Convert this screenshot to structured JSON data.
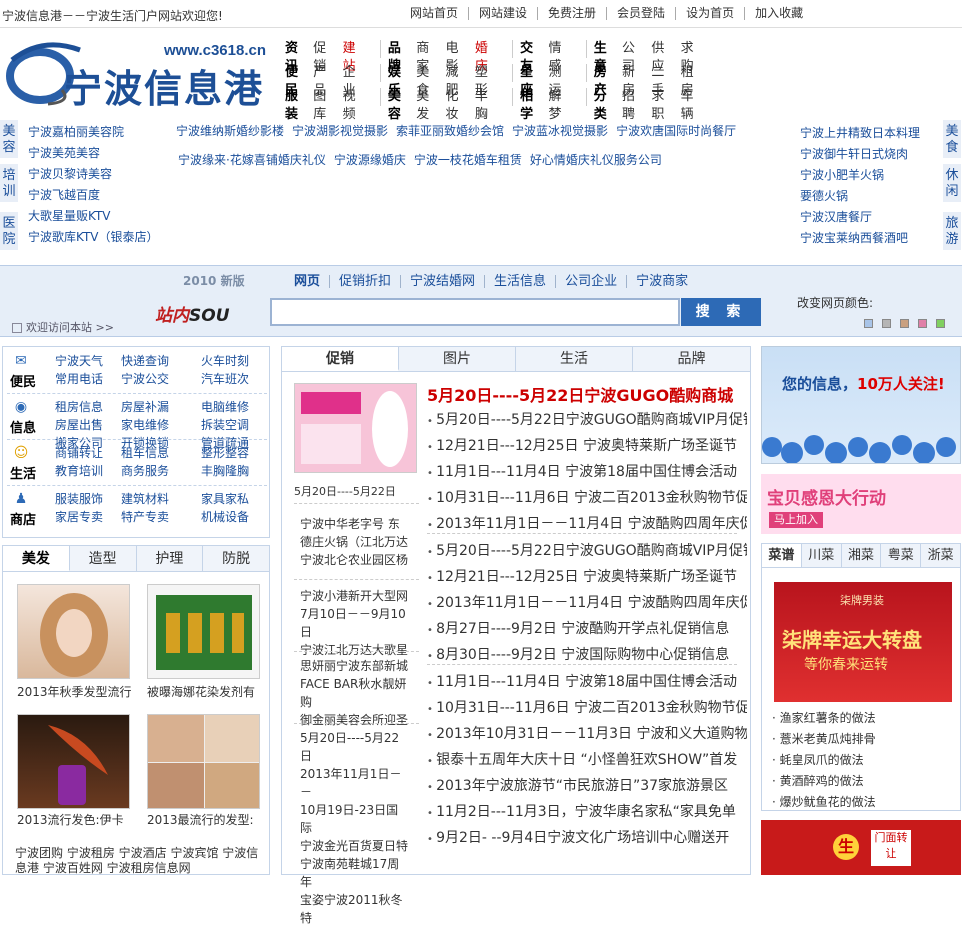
{
  "topbar": {
    "welcome": "宁波信息港－－宁波生活门户网站欢迎您!",
    "links": [
      "网站首页",
      "网站建设",
      "免费注册",
      "会员登陆",
      "设为首页",
      "加入收藏"
    ]
  },
  "logo": {
    "name": "宁波信息港",
    "url": "www.c3618.cn"
  },
  "catnav": [
    [
      {
        "head": "资讯",
        "items": [
          {
            "t": "促销"
          },
          {
            "t": "建站",
            "red": true
          }
        ]
      },
      {
        "head": "品牌",
        "items": [
          {
            "t": "商家"
          },
          {
            "t": "电影"
          },
          {
            "t": "婚庆",
            "red": true
          }
        ]
      },
      {
        "head": "交友",
        "items": [
          {
            "t": "情感"
          }
        ]
      },
      {
        "head": "生意",
        "items": [
          {
            "t": "公司"
          },
          {
            "t": "供应"
          },
          {
            "t": "求购"
          }
        ]
      }
    ],
    [
      {
        "head": "便民",
        "items": [
          {
            "t": "产品"
          },
          {
            "t": "企业"
          }
        ]
      },
      {
        "head": "娱乐",
        "items": [
          {
            "t": "美食"
          },
          {
            "t": "减肥"
          },
          {
            "t": "塑形"
          }
        ]
      },
      {
        "head": "星座",
        "items": [
          {
            "t": "测运"
          }
        ]
      },
      {
        "head": "房产",
        "items": [
          {
            "t": "新房"
          },
          {
            "t": "二手"
          },
          {
            "t": "租房"
          }
        ]
      }
    ],
    [
      {
        "head": "服装",
        "items": [
          {
            "t": "图库"
          },
          {
            "t": "视频"
          }
        ]
      },
      {
        "head": "美容",
        "items": [
          {
            "t": "美发"
          },
          {
            "t": "化妆"
          },
          {
            "t": "丰胸"
          }
        ]
      },
      {
        "head": "相学",
        "items": [
          {
            "t": "解梦"
          }
        ]
      },
      {
        "head": "分类",
        "items": [
          {
            "t": "招聘"
          },
          {
            "t": "求职"
          },
          {
            "t": "车辆"
          }
        ]
      }
    ]
  ],
  "ads": {
    "left_tabs": [
      "美容",
      "培训",
      "医院"
    ],
    "right_tabs": [
      "美食",
      "休闲",
      "旅游"
    ],
    "left_col": [
      "宁波嘉柏丽美容院",
      "宁波美苑美容",
      "宁波贝黎诗美容",
      "宁波飞越百度",
      "大歌星量贩KTV",
      "宁波歌库KTV（银泰店）"
    ],
    "mid_row1": [
      "宁波维纳斯婚纱影楼",
      "宁波湖影视觉摄影",
      "索菲亚丽致婚纱会馆",
      "宁波蓝冰视觉摄影",
      "宁波欢唐国际时尚餐厅"
    ],
    "mid_row2": [
      "宁波缘来·花嫁喜铺婚庆礼仪",
      "宁波源缘婚庆",
      "宁波一枝花婚车租赁",
      "好心情婚庆礼仪服务公司"
    ],
    "right_col": [
      "宁波上井精致日本料理",
      "宁波御牛轩日式烧肉",
      "宁波小肥羊火锅",
      "要德火锅",
      "宁波汉唐餐厅",
      "宁波宝莱纳西餐酒吧"
    ]
  },
  "search": {
    "version": "2010 新版",
    "tabs": [
      "网页",
      "促销折扣",
      "宁波结婚网",
      "生活信息",
      "公司企业",
      "宁波商家"
    ],
    "brand_red": "站内",
    "brand_dark": "SOU",
    "placeholder": "",
    "button": "搜 索",
    "color_label": "改变网页颜色:",
    "welcome": "欢迎访问本站 >>",
    "swatches": [
      "#a8c4e8",
      "#b5b5b5",
      "#c9a080",
      "#e080a8",
      "#80d060"
    ]
  },
  "services": [
    {
      "label": "便民",
      "icon": "mail-icon",
      "items": [
        "宁波天气",
        "快递查询",
        "火车时刻",
        "常用电话",
        "宁波公交",
        "汽车班次"
      ]
    },
    {
      "label": "信息",
      "icon": "gamepad-icon",
      "items": [
        "租房信息",
        "房屋补漏",
        "电脑维修",
        "房屋出售",
        "家电维修",
        "拆装空调",
        "搬家公司",
        "开锁换锁",
        "管道疏通"
      ]
    },
    {
      "label": "生活",
      "icon": "smiley-icon",
      "items": [
        "商铺转让",
        "租车信息",
        "整形整容",
        "教育培训",
        "商务服务",
        "丰胸隆胸"
      ]
    },
    {
      "label": "商店",
      "icon": "person-icon",
      "items": [
        "服装服饰",
        "建筑材料",
        "家具家私",
        "家居专卖",
        "特产专卖",
        "机械设备"
      ]
    }
  ],
  "beauty": {
    "tabs": [
      "美发",
      "造型",
      "护理",
      "防脱"
    ],
    "captions": [
      "2013年秋季发型流行",
      "被曝海娜花染发剂有",
      "2013流行发色:伊卡",
      "2013最流行的发型:"
    ],
    "bottom_links": "宁波团购 宁波租房 宁波酒店 宁波宾馆 宁波信息港 宁波百姓网 宁波租房信息网"
  },
  "promo": {
    "tabs": [
      "促销",
      "图片",
      "生活",
      "品牌"
    ],
    "image_caption": "5月20日----5月22日",
    "left_group1": [
      "宁波中华老字号 东",
      "德庄火锅（江北万达",
      "宁波北仑农业园区杨"
    ],
    "left_group2": [
      "宁波小港新开大型网",
      "7月10日－－9月10日",
      "宁波江北万达大歌星"
    ],
    "left_group3": [
      "思妍丽宁波东部新城",
      "FACE BAR秋水靓妍购",
      "御金丽美容会所迎圣"
    ],
    "left_group4": [
      "5月20日----5月22日",
      "2013年11月1日－－",
      "10月19日-23日国际",
      "宁波金光百货夏日特",
      "宁波南苑鞋城17周年",
      "宝姿宁波2011秋冬特"
    ],
    "headline": "5月20日----5月22日宁波GUGO酷购商城",
    "list1": [
      "5月20日----5月22日宁波GUGO酷购商城VIP月促销",
      "12月21日---12月25日 宁波奥特莱斯广场圣诞节",
      "11月1日---11月4日 宁波第18届中国住博会活动",
      "10月31日---11月6日 宁波二百2013金秋购物节促",
      "2013年11月1日－－11月4日 宁波酷购四周年庆促"
    ],
    "list2": [
      "5月20日----5月22日宁波GUGO酷购商城VIP月促销",
      "12月21日---12月25日 宁波奥特莱斯广场圣诞节",
      "2013年11月1日－－11月4日 宁波酷购四周年庆促",
      "8月27日----9月2日 宁波酷购开学点礼促销信息",
      "8月30日----9月2日 宁波国际购物中心促销信息"
    ],
    "list3": [
      "11月1日---11月4日 宁波第18届中国住博会活动",
      "10月31日---11月6日 宁波二百2013金秋购物节促",
      "2013年10月31日－－11月3日 宁波和义大道购物",
      "银泰十五周年大庆十日 “小怪兽狂欢SHOW”首发",
      "2013年宁波旅游节“市民旅游日”37家旅游景区",
      "11月2日---11月3日，宁波华康名家私“家具免单",
      "9月2日- --9月4日宁波文化广场培训中心赠送开"
    ]
  },
  "right": {
    "ad_top_text": "您的信息，",
    "ad_top_highlight": "10万人关注!",
    "ad_mid_text": "宝贝感恩大行动",
    "ad_mid_button": "马上加入",
    "recipe_tabs": [
      "菜谱",
      "川菜",
      "湘菜",
      "粤菜",
      "浙菜"
    ],
    "recipe_brand": "柒牌男装",
    "recipe_big": "柒牌幸运大转盘",
    "recipe_sub": "等你春来运转",
    "recipe_list": [
      "渔家红薯条的做法",
      "薏米老黄瓜炖排骨",
      "蚝皇凤爪的做法",
      "黄酒醉鸡的做法",
      "爆炒鱿鱼花的做法"
    ],
    "ad_bot_char": "生",
    "ad_bot_text": "门面转让"
  }
}
